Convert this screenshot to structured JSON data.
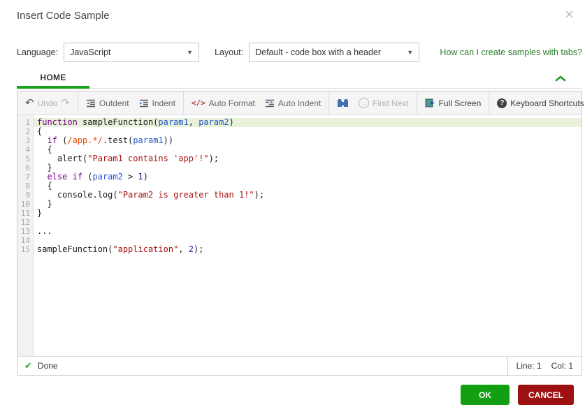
{
  "dialog": {
    "title": "Insert Code Sample"
  },
  "icons": {
    "close": "×",
    "undo": "↶",
    "redo": "↷",
    "caret_down": "▼",
    "check": "✔",
    "auto_format": "</>",
    "help": "?",
    "find_next_arrow": "→"
  },
  "options": {
    "language_label": "Language:",
    "language_value": "JavaScript",
    "layout_label": "Layout:",
    "layout_value": "Default - code box with a header",
    "help_link": "How can I create samples with tabs?"
  },
  "tabs": {
    "home": "HOME"
  },
  "toolbar": {
    "undo": "Undo",
    "outdent": "Outdent",
    "indent": "Indent",
    "auto_format": "Auto Format",
    "auto_indent": "Auto Indent",
    "find_next": "Find Next",
    "full_screen": "Full Screen",
    "keyboard_shortcuts": "Keyboard Shortcuts"
  },
  "editor": {
    "lines": [
      {
        "n": 1,
        "h": true,
        "t": [
          [
            "kw",
            "function"
          ],
          [
            "pl",
            " sampleFunction("
          ],
          [
            "vr",
            "param1"
          ],
          [
            "pl",
            ", "
          ],
          [
            "vr",
            "param2"
          ],
          [
            "pl",
            ")"
          ]
        ]
      },
      {
        "n": 2,
        "h": false,
        "t": [
          [
            "pl",
            "{"
          ]
        ]
      },
      {
        "n": 3,
        "h": false,
        "t": [
          [
            "pl",
            "  "
          ],
          [
            "kw",
            "if"
          ],
          [
            "pl",
            " ("
          ],
          [
            "re",
            "/app.*/"
          ],
          [
            "pl",
            ".test("
          ],
          [
            "vr",
            "param1"
          ],
          [
            "pl",
            "))"
          ]
        ]
      },
      {
        "n": 4,
        "h": false,
        "t": [
          [
            "pl",
            "  {"
          ]
        ]
      },
      {
        "n": 5,
        "h": false,
        "t": [
          [
            "pl",
            "    alert("
          ],
          [
            "st",
            "\"Param1 contains 'app'!\""
          ],
          [
            "pl",
            ");"
          ]
        ]
      },
      {
        "n": 6,
        "h": false,
        "t": [
          [
            "pl",
            "  }"
          ]
        ]
      },
      {
        "n": 7,
        "h": false,
        "t": [
          [
            "pl",
            "  "
          ],
          [
            "kw",
            "else"
          ],
          [
            "pl",
            " "
          ],
          [
            "kw",
            "if"
          ],
          [
            "pl",
            " ("
          ],
          [
            "vr",
            "param2"
          ],
          [
            "pl",
            " > "
          ],
          [
            "nu",
            "1"
          ],
          [
            "pl",
            ")"
          ]
        ]
      },
      {
        "n": 8,
        "h": false,
        "t": [
          [
            "pl",
            "  {"
          ]
        ]
      },
      {
        "n": 9,
        "h": false,
        "t": [
          [
            "pl",
            "    console.log("
          ],
          [
            "st",
            "\"Param2 is greater than 1!\""
          ],
          [
            "pl",
            ");"
          ]
        ]
      },
      {
        "n": 10,
        "h": false,
        "t": [
          [
            "pl",
            "  }"
          ]
        ]
      },
      {
        "n": 11,
        "h": false,
        "t": [
          [
            "pl",
            "}"
          ]
        ]
      },
      {
        "n": 12,
        "h": false,
        "t": []
      },
      {
        "n": 13,
        "h": false,
        "t": [
          [
            "pl",
            "..."
          ]
        ]
      },
      {
        "n": 14,
        "h": false,
        "t": []
      },
      {
        "n": 15,
        "h": false,
        "t": [
          [
            "pl",
            "sampleFunction("
          ],
          [
            "st",
            "\"application\""
          ],
          [
            "pl",
            ", "
          ],
          [
            "nu",
            "2"
          ],
          [
            "pl",
            ");"
          ]
        ]
      }
    ]
  },
  "statusbar": {
    "status": "Done",
    "line": "Line: 1",
    "col": "Col: 1"
  },
  "footer": {
    "ok": "OK",
    "cancel": "CANCEL"
  },
  "colors": {
    "accent_green": "#1aa11a",
    "link_green": "#2c7d2c",
    "ok_green": "#12a012",
    "cancel_red": "#9d1112",
    "line_highlight": "#e8f2da",
    "syntax_keyword": "#770088",
    "syntax_variable": "#2454cc",
    "syntax_string": "#aa1111",
    "syntax_regex": "#ee4400",
    "syntax_number": "#221199"
  }
}
